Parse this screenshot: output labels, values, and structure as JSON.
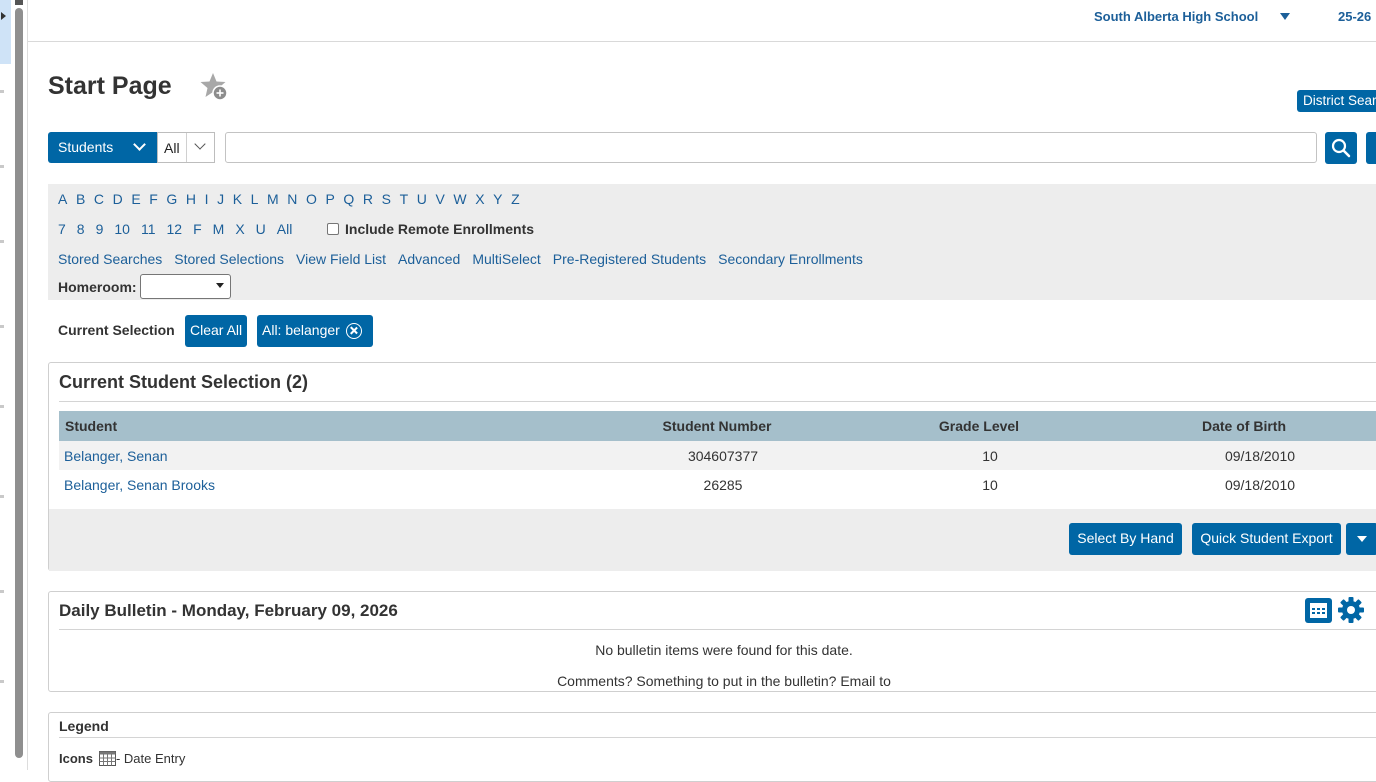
{
  "header": {
    "school": "South Alberta High School",
    "term": "25-26"
  },
  "page": {
    "title": "Start Page",
    "district_search": "District Search"
  },
  "search": {
    "scope": "Students",
    "filter": "All",
    "query": "",
    "placeholder": ""
  },
  "filters": {
    "letters": [
      "A",
      "B",
      "C",
      "D",
      "E",
      "F",
      "G",
      "H",
      "I",
      "J",
      "K",
      "L",
      "M",
      "N",
      "O",
      "P",
      "Q",
      "R",
      "S",
      "T",
      "U",
      "V",
      "W",
      "X",
      "Y",
      "Z"
    ],
    "grades": [
      "7",
      "8",
      "9",
      "10",
      "11",
      "12",
      "F",
      "M",
      "X",
      "U",
      "All"
    ],
    "include_remote_label": "Include Remote Enrollments",
    "include_remote_checked": false,
    "links": [
      "Stored Searches",
      "Stored Selections",
      "View Field List",
      "Advanced",
      "MultiSelect",
      "Pre-Registered Students",
      "Secondary Enrollments"
    ],
    "homeroom_label": "Homeroom:",
    "homeroom_value": ""
  },
  "selection": {
    "label": "Current Selection",
    "clear_all": "Clear All",
    "chip": "All: belanger"
  },
  "student_box": {
    "title": "Current Student Selection (2)",
    "columns": {
      "student": "Student",
      "number": "Student Number",
      "grade": "Grade Level",
      "dob": "Date of Birth"
    },
    "rows": [
      {
        "student": "Belanger, Senan",
        "number": "304607377",
        "grade": "10",
        "dob": "09/18/2010"
      },
      {
        "student": "Belanger, Senan Brooks",
        "number": "26285",
        "grade": "10",
        "dob": "09/18/2010"
      }
    ],
    "select_by_hand": "Select By Hand",
    "quick_export": "Quick Student Export"
  },
  "bulletin": {
    "title": "Daily Bulletin - Monday, February 09, 2026",
    "no_items": "No bulletin items were found for this date.",
    "comments": "Comments? Something to put in the bulletin? Email to"
  },
  "legend": {
    "title": "Legend",
    "icons_label": "Icons",
    "date_entry": "- Date Entry"
  },
  "colors": {
    "accent": "#0066a5",
    "link": "#1c5f99",
    "table_header": "#a5bfcb",
    "panel": "#ededed"
  }
}
